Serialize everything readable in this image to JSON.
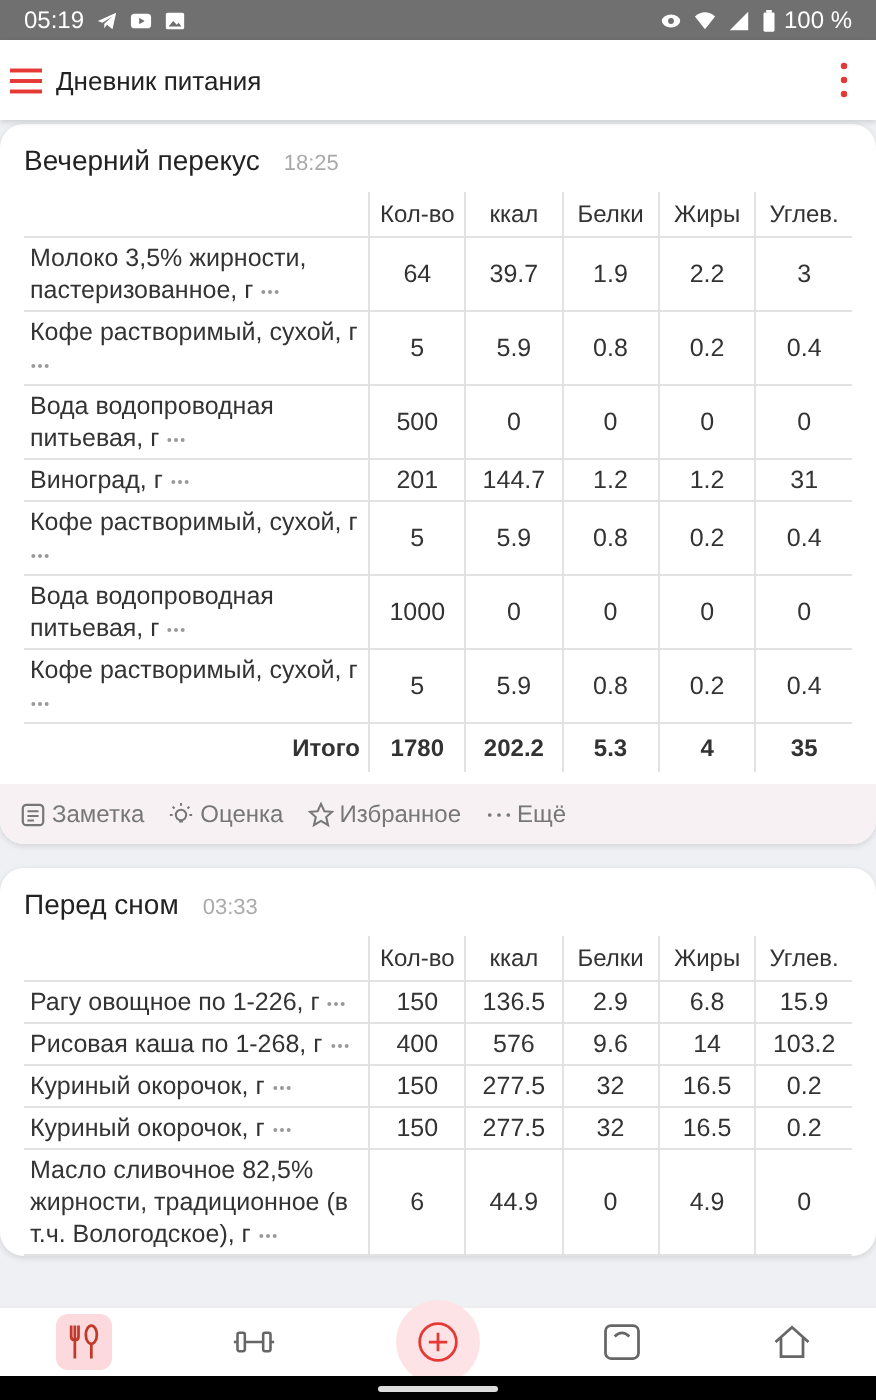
{
  "status_bar": {
    "time": "05:19",
    "battery": "100 %"
  },
  "app_bar": {
    "title": "Дневник питания"
  },
  "meals": [
    {
      "title": "Вечерний перекус",
      "time": "18:25",
      "columns": [
        "Кол-во",
        "ккал",
        "Белки",
        "Жиры",
        "Углев."
      ],
      "rows": [
        {
          "name": "Молоко 3,5% жирности, пастеризованное, г",
          "values": [
            "64",
            "39.7",
            "1.9",
            "2.2",
            "3"
          ]
        },
        {
          "name": "Кофе растворимый, сухой, г",
          "values": [
            "5",
            "5.9",
            "0.8",
            "0.2",
            "0.4"
          ]
        },
        {
          "name": "Вода водопроводная питьевая, г",
          "values": [
            "500",
            "0",
            "0",
            "0",
            "0"
          ]
        },
        {
          "name": "Виноград, г",
          "values": [
            "201",
            "144.7",
            "1.2",
            "1.2",
            "31"
          ]
        },
        {
          "name": "Кофе растворимый, сухой, г",
          "values": [
            "5",
            "5.9",
            "0.8",
            "0.2",
            "0.4"
          ]
        },
        {
          "name": "Вода водопроводная питьевая, г",
          "values": [
            "1000",
            "0",
            "0",
            "0",
            "0"
          ]
        },
        {
          "name": "Кофе растворимый, сухой, г",
          "values": [
            "5",
            "5.9",
            "0.8",
            "0.2",
            "0.4"
          ]
        }
      ],
      "total": {
        "label": "Итого",
        "values": [
          "1780",
          "202.2",
          "5.3",
          "4",
          "35"
        ]
      },
      "actions": [
        {
          "kind": "note",
          "label": "Заметка"
        },
        {
          "kind": "rate",
          "label": "Оценка"
        },
        {
          "kind": "favorite",
          "label": "Избранное"
        },
        {
          "kind": "more",
          "label": "Ещё"
        }
      ]
    },
    {
      "title": "Перед сном",
      "time": "03:33",
      "columns": [
        "Кол-во",
        "ккал",
        "Белки",
        "Жиры",
        "Углев."
      ],
      "rows": [
        {
          "name": "Рагу овощное по 1-226, г",
          "values": [
            "150",
            "136.5",
            "2.9",
            "6.8",
            "15.9"
          ]
        },
        {
          "name": "Рисовая каша по 1-268, г",
          "values": [
            "400",
            "576",
            "9.6",
            "14",
            "103.2"
          ]
        },
        {
          "name": "Куриный окорочок, г",
          "values": [
            "150",
            "277.5",
            "32",
            "16.5",
            "0.2"
          ]
        },
        {
          "name": "Куриный окорочок, г",
          "values": [
            "150",
            "277.5",
            "32",
            "16.5",
            "0.2"
          ]
        },
        {
          "name": "Масло сливочное 82,5% жирности, традиционное (в т.ч. Вологодское), г",
          "values": [
            "6",
            "44.9",
            "0",
            "4.9",
            "0"
          ]
        }
      ]
    }
  ],
  "bottom_nav": [
    {
      "kind": "diary",
      "selected": true
    },
    {
      "kind": "exercise",
      "selected": false
    },
    {
      "kind": "add"
    },
    {
      "kind": "weight",
      "selected": false
    },
    {
      "kind": "home",
      "selected": false
    }
  ]
}
